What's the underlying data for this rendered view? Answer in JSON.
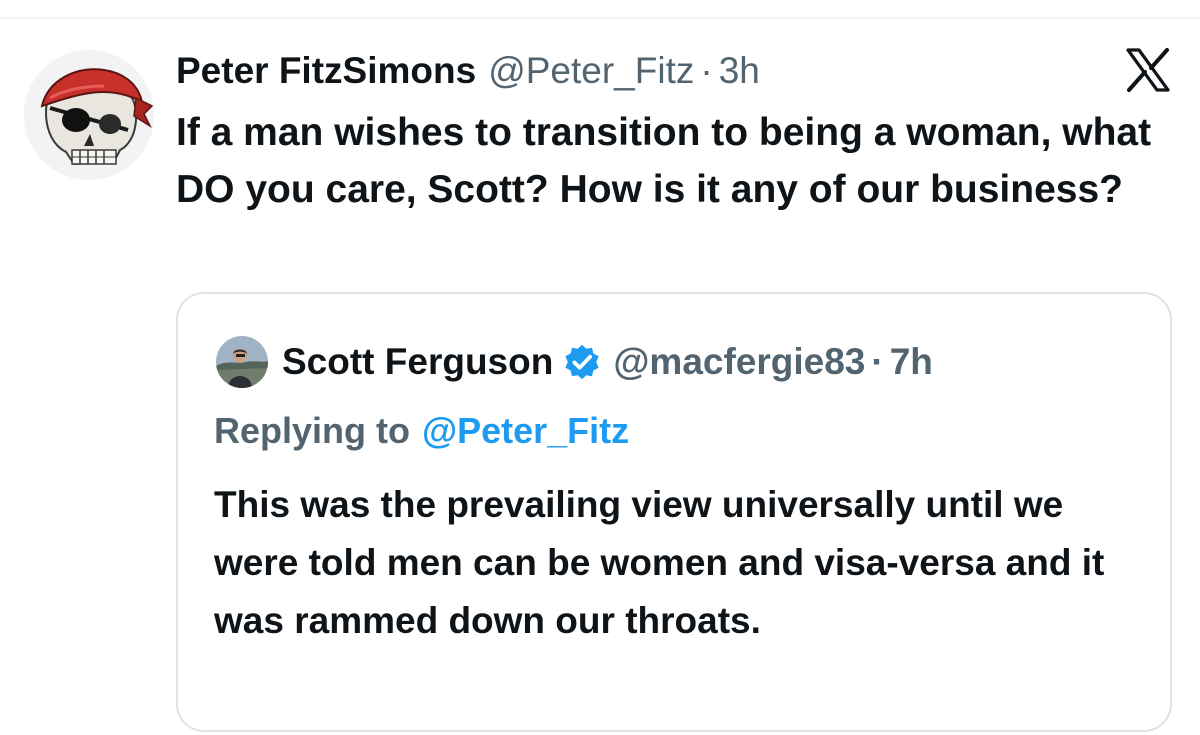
{
  "tweet": {
    "author_name": "Peter FitzSimons",
    "author_handle": "@Peter_Fitz",
    "separator": "·",
    "time": "3h",
    "text": "If a man wishes to transition to being a woman, what DO you care, Scott? How is it any of our business?"
  },
  "quoted_tweet": {
    "author_name": "Scott Ferguson",
    "author_handle": "@macfergie83",
    "separator": "·",
    "time": "7h",
    "replying_label": "Replying to",
    "replying_handle": "@Peter_Fitz",
    "text": "This was the prevailing view universally until we were told men can be women and visa-versa and it was rammed down our throats."
  },
  "icons": {
    "platform_logo": "x-logo-icon",
    "verified": "verified-badge-icon",
    "author_avatar": "pirate-skull-avatar",
    "quoted_avatar": "person-photo-avatar"
  },
  "colors": {
    "text_primary": "#0f1419",
    "text_secondary": "#536471",
    "link_blue": "#1d9bf0",
    "border": "#dfe3e6",
    "bandana_red": "#c8302c"
  }
}
